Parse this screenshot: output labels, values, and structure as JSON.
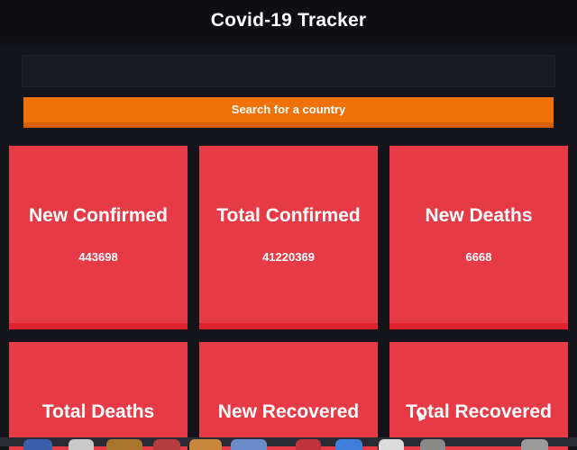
{
  "header": {
    "title": "Covid-19 Tracker"
  },
  "search": {
    "value": "",
    "placeholder": "",
    "button_label": "Search for a country"
  },
  "cards": [
    {
      "title": "New Confirmed",
      "value": "443698"
    },
    {
      "title": "Total Confirmed",
      "value": "41220369"
    },
    {
      "title": "New Deaths",
      "value": "6668"
    },
    {
      "title": "Total Deaths",
      "value": ""
    },
    {
      "title": "New Recovered",
      "value": ""
    },
    {
      "title": "Total Recovered",
      "value": ""
    }
  ],
  "colors": {
    "background": "#14141b",
    "header": "#0f0f13",
    "accent": "#f07107",
    "card": "#e63b47"
  }
}
